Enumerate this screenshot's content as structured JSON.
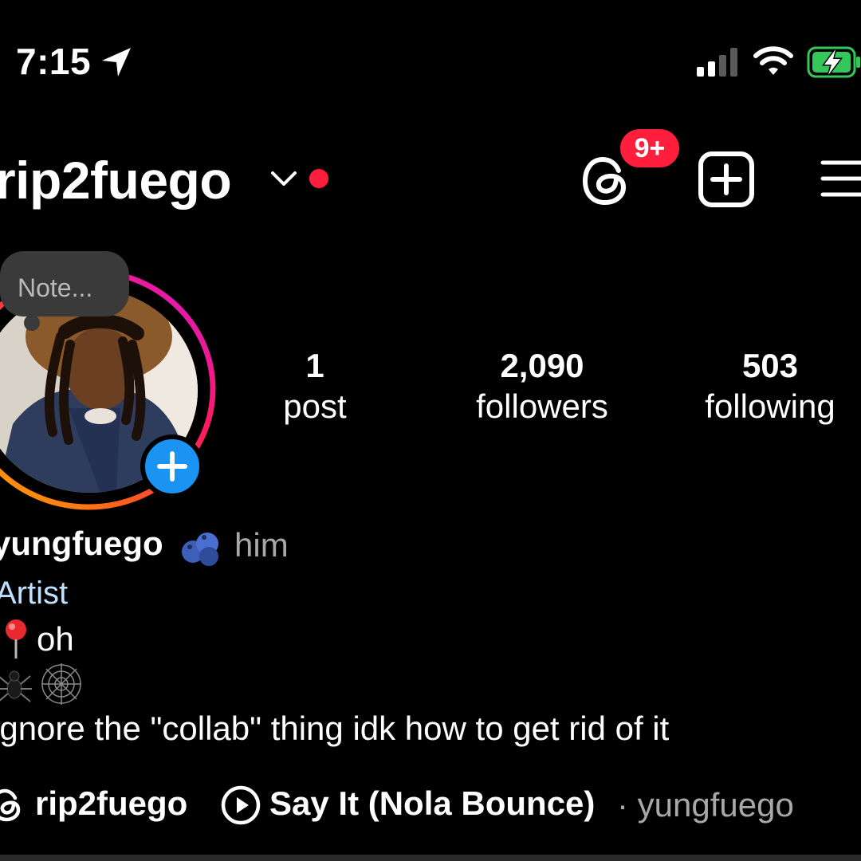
{
  "status_bar": {
    "time": "7:15",
    "location_icon": "location-arrow-icon",
    "signal_icon": "cellular-signal-icon",
    "wifi_icon": "wifi-icon",
    "battery_icon": "battery-charging-icon"
  },
  "header": {
    "username": "rip2fuego",
    "threads_badge": "9+",
    "accent_red": "#ff1f3d"
  },
  "profile": {
    "note_placeholder": "Note...",
    "stats": {
      "posts_count": "1",
      "posts_label": "post",
      "followers_count": "2,090",
      "followers_label": "followers",
      "following_count": "503",
      "following_label": "following"
    }
  },
  "bio": {
    "display_name": "yungfuego",
    "pronouns": "him",
    "category": "Artist",
    "line1": "oh",
    "line2": "ignore the \"collab\" thing idk how to get rid of it"
  },
  "links": {
    "threads_handle": "rip2fuego",
    "music_title": "Say It (Nola Bounce)",
    "music_artist": "· yungfuego"
  },
  "colors": {
    "story_add_blue": "#1a93f3",
    "category_blue": "#bfe0ff"
  }
}
